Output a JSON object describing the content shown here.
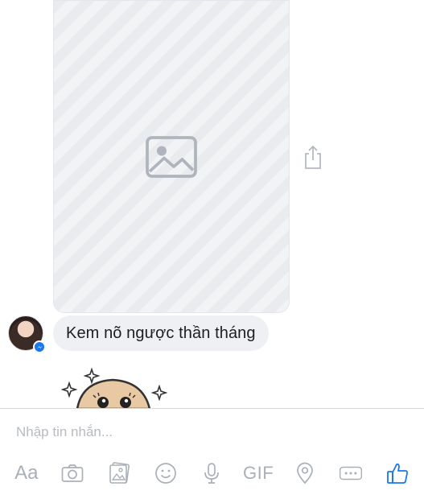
{
  "thread": {
    "incoming_text": "Kem nõ ngược thần tháng"
  },
  "composer": {
    "placeholder": "Nhập tin nhắn..."
  },
  "toolbar": {
    "text_label": "Aa",
    "gif_label": "GIF",
    "icons": [
      "text-format",
      "camera",
      "gallery",
      "emoji",
      "microphone",
      "gif",
      "location",
      "more",
      "like"
    ]
  },
  "colors": {
    "accent": "#1877f2",
    "bubble_bg": "#eff0f3",
    "icon_gray": "#aab0b8"
  }
}
